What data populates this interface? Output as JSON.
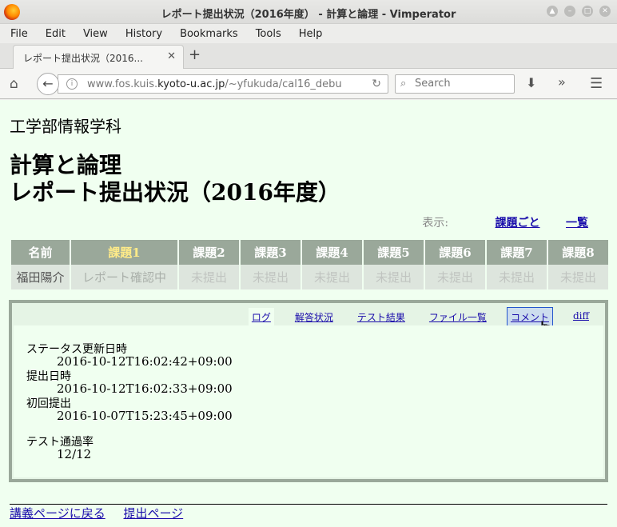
{
  "window": {
    "title": "レポート提出状況（2016年度） - 計算と論理 - Vimperator"
  },
  "menu": [
    "File",
    "Edit",
    "View",
    "History",
    "Bookmarks",
    "Tools",
    "Help"
  ],
  "tab": {
    "label": "レポート提出状況（2016...",
    "close": "✕"
  },
  "nav": {
    "url_prefix": "www.fos.kuis.",
    "url_domain": "kyoto-u.ac.jp",
    "url_suffix": "/~yfukuda/cal16_debu",
    "search_placeholder": "Search"
  },
  "page": {
    "department": "工学部情報学科",
    "title_line1": "計算と論理",
    "title_line2": "レポート提出状況（2016年度）",
    "view_label": "表示:",
    "view_by_task": "課題ごと",
    "view_list": "一覧"
  },
  "table": {
    "headers": [
      "名前",
      "課題1",
      "課題2",
      "課題3",
      "課題4",
      "課題5",
      "課題6",
      "課題7",
      "課題8"
    ],
    "row": [
      "福田陽介",
      "レポート確認中",
      "未提出",
      "未提出",
      "未提出",
      "未提出",
      "未提出",
      "未提出",
      "未提出"
    ]
  },
  "panel": {
    "tabs": [
      "ログ",
      "解答状況",
      "テスト結果",
      "ファイル一覧",
      "コメント",
      "diff"
    ],
    "fields": [
      {
        "label": "ステータス更新日時",
        "value": "2016-10-12T16:02:42+09:00"
      },
      {
        "label": "提出日時",
        "value": "2016-10-12T16:02:33+09:00"
      },
      {
        "label": "初回提出",
        "value": "2016-10-07T15:23:45+09:00"
      },
      {
        "label": "テスト通過率",
        "value": "12/12"
      }
    ]
  },
  "footer": {
    "back": "講義ページに戻る",
    "submit": "提出ページ"
  }
}
